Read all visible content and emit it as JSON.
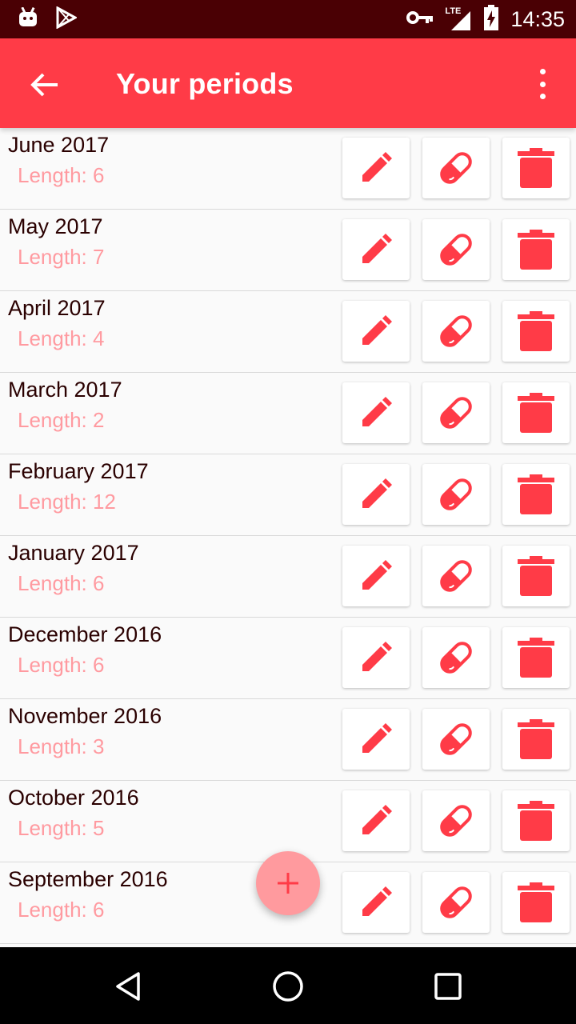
{
  "status_bar": {
    "time": "14:35",
    "network": "LTE",
    "icons": [
      "android-debug-icon",
      "play-store-icon",
      "vpn-key-icon",
      "signal-icon",
      "battery-charging-icon"
    ]
  },
  "app_bar": {
    "title": "Your periods",
    "back_icon": "arrow-back-icon",
    "menu_icon": "more-vert-icon",
    "color": "#ff3b47"
  },
  "periods": [
    {
      "month": "June 2017",
      "length": "Length: 6"
    },
    {
      "month": "May 2017",
      "length": "Length: 7"
    },
    {
      "month": "April 2017",
      "length": "Length: 4"
    },
    {
      "month": "March 2017",
      "length": "Length: 2"
    },
    {
      "month": "February 2017",
      "length": "Length: 12"
    },
    {
      "month": "January 2017",
      "length": "Length: 6"
    },
    {
      "month": "December 2016",
      "length": "Length: 6"
    },
    {
      "month": "November 2016",
      "length": "Length: 3"
    },
    {
      "month": "October 2016",
      "length": "Length: 5"
    },
    {
      "month": "September 2016",
      "length": "Length: 6"
    }
  ],
  "row_actions": [
    "edit-icon",
    "pill-icon",
    "delete-icon"
  ],
  "fab": {
    "icon": "add-icon",
    "color": "#ff9a9e"
  },
  "nav_bar": [
    "back-triangle-icon",
    "home-circle-icon",
    "recents-square-icon"
  ],
  "colors": {
    "accent": "#ff3b47",
    "secondary_text": "#ff9aa0",
    "status_bar": "#4a0004"
  }
}
